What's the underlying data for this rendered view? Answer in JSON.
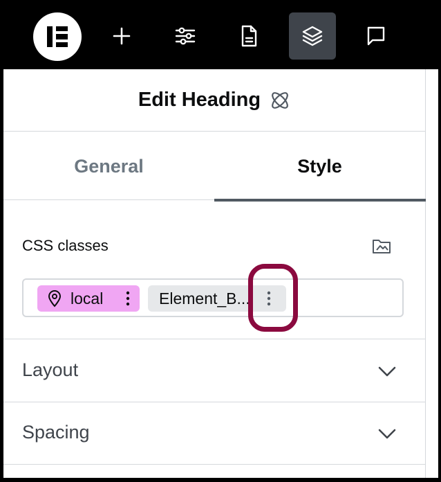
{
  "topbar": {
    "logo": "elementor-logo",
    "buttons": [
      {
        "icon": "plus-icon"
      },
      {
        "icon": "sliders-icon"
      },
      {
        "icon": "page-icon"
      },
      {
        "icon": "layers-icon",
        "active": true
      },
      {
        "icon": "comment-icon"
      }
    ]
  },
  "header": {
    "title": "Edit Heading",
    "icon": "atomic-icon"
  },
  "tabs": {
    "general": "General",
    "style": "Style",
    "active": "Style"
  },
  "css_classes": {
    "label": "CSS classes",
    "chips": [
      {
        "label": "local",
        "icon": "map-pin-icon",
        "color": "#f0a6f3"
      },
      {
        "label": "Element_B...",
        "color": "#e6e8ea"
      }
    ]
  },
  "sections": {
    "layout": "Layout",
    "spacing": "Spacing"
  },
  "colors": {
    "highlight": "#8b0a3f",
    "local_chip": "#f0a6f3",
    "active_tab_bg": "#3f444b"
  }
}
